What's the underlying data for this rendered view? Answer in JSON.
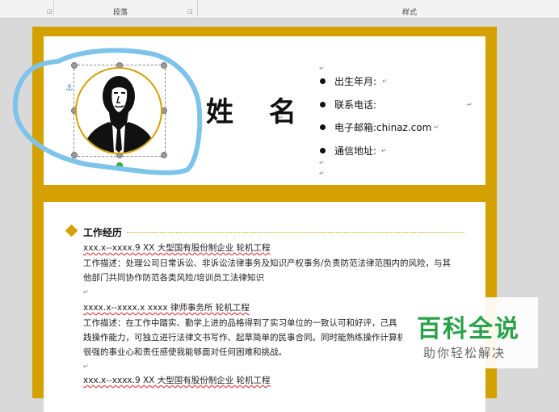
{
  "ribbon": {
    "paragraph_group_label": "段落",
    "styles_group_label": "样式"
  },
  "header": {
    "name": "姓 名",
    "info": [
      {
        "label": "出生年月:"
      },
      {
        "label": "联系电话:"
      },
      {
        "label": "电子邮箱:",
        "value": "chinaz.com"
      },
      {
        "label": "通信地址:"
      }
    ]
  },
  "experience": {
    "title": "工作经历",
    "lines": [
      "xxx.x--xxxx.9            XX 大型国有股份制企业         轮机工程",
      "工作描述：处理公司日常诉讼、非诉讼法律事务及知识产权事务/负责防范法律范围内的风险，与其",
      "他部门共同协作防范各类风险/培训员工法律知识",
      "xxxx.x--xxxx.x           xxxx 律师事务所             轮机工程",
      "工作描述：在工作中踏实、勤学上进的品格得到了实习单位的一致认可和好评，己具",
      "践操作能力，可独立进行法律文书写作、起草简单的民事合同。同时能熟练操作计算机",
      "很强的事业心和责任感使我能够面对任何困难和挑战。",
      "xxx.x--xxxx.9            XX 大型国有股份制企业         轮机工程"
    ]
  },
  "watermark": {
    "main": "百科全说",
    "sub": "助你轻松解决"
  },
  "colors": {
    "accent": "#d4a100",
    "watermark_green": "#2aa24a",
    "annotation_blue": "#7ec4ea"
  },
  "icons": [
    "anchor-icon",
    "paragraph-mark-icon",
    "bullet-icon",
    "diamond-icon",
    "portrait-image"
  ]
}
